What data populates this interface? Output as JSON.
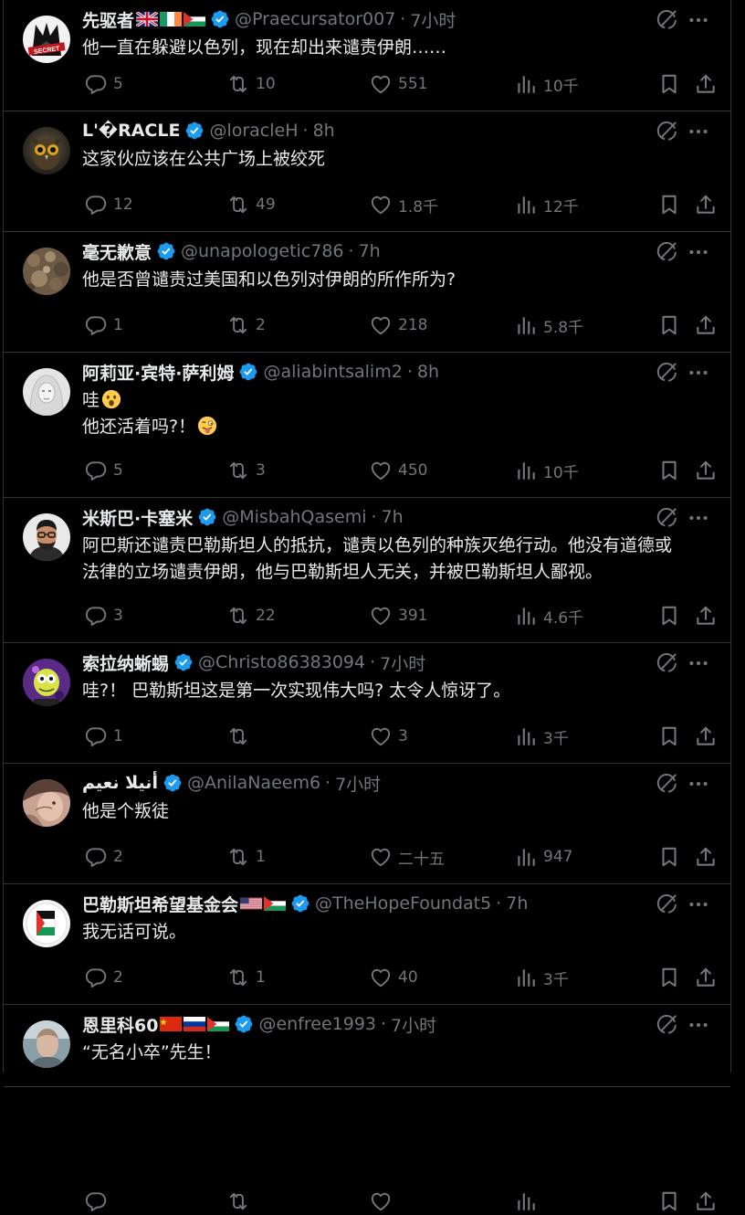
{
  "colors": {
    "background": "#000000",
    "text_primary": "#e7e9ea",
    "text_secondary": "#71767b",
    "divider": "#2f3336",
    "verified_blue": "#1d9bf0"
  },
  "tweets": [
    {
      "name": "先驱者",
      "flags": [
        "uk",
        "ireland",
        "palestine"
      ],
      "handle": "@Praecursator007",
      "time": "7小时",
      "lines": [
        "他一直在躲避以色列，现在却出来谴责伊朗……"
      ],
      "emoji": [],
      "stats": {
        "replies": "5",
        "retweets": "10",
        "likes": "551",
        "views": "10千"
      },
      "avatar": "wolf-logo"
    },
    {
      "name": "L'�RACLE",
      "flags": [],
      "handle": "@loracleH",
      "time": "8h",
      "lines": [
        "这家伙应该在公共广场上被绞死"
      ],
      "emoji": [],
      "stats": {
        "replies": "12",
        "retweets": "49",
        "likes": "1.8千",
        "views": "12千"
      },
      "avatar": "owl"
    },
    {
      "name": "毫无歉意",
      "flags": [],
      "handle": "@unapologetic786",
      "time": "7h",
      "lines": [
        "他是否曾谴责过美国和以色列对伊朗的所作所为?"
      ],
      "emoji": [],
      "stats": {
        "replies": "1",
        "retweets": "2",
        "likes": "218",
        "views": "5.8千"
      },
      "avatar": "texture"
    },
    {
      "name": "阿莉亚·宾特·萨利姆",
      "flags": [],
      "handle": "@aliabintsalim2",
      "time": "8h",
      "lines": [
        "哇",
        "他还活着吗?！"
      ],
      "emoji": [
        "astonished-face",
        "winking-tongue-face"
      ],
      "stats": {
        "replies": "5",
        "retweets": "3",
        "likes": "450",
        "views": "10千"
      },
      "avatar": "hijab-woman"
    },
    {
      "name": "米斯巴·卡塞米",
      "flags": [],
      "handle": "@MisbahQasemi",
      "time": "7h",
      "lines": [
        "阿巴斯还谴责巴勒斯坦人的抵抗，谴责以色列的种族灭绝行动。他没有道德或",
        "法律的立场谴责伊朗，他与巴勒斯坦人无关，并被巴勒斯坦人鄙视。"
      ],
      "emoji": [],
      "stats": {
        "replies": "3",
        "retweets": "22",
        "likes": "391",
        "views": "4.6千"
      },
      "avatar": "man-glasses"
    },
    {
      "name": "索拉纳蜥蜴",
      "flags": [],
      "handle": "@Christo86383094",
      "time": "7小时",
      "lines": [
        "哇?！ 巴勒斯坦这是第一次实现伟大吗? 太令人惊讶了。"
      ],
      "emoji": [],
      "stats": {
        "replies": "1",
        "retweets": "",
        "likes": "3",
        "views": "3千"
      },
      "avatar": "cartoon-lizard"
    },
    {
      "name": "أنيلا نعيم",
      "flags": [],
      "handle": "@AnilaNaeem6",
      "time": "7小时",
      "lines": [
        "他是个叛徒"
      ],
      "emoji": [],
      "stats": {
        "replies": "2",
        "retweets": "1",
        "likes": "二十五",
        "views": "947"
      },
      "avatar": "portrait-blur"
    },
    {
      "name": "巴勒斯坦希望基金会",
      "flags": [
        "usa",
        "palestine"
      ],
      "handle": "@TheHopeFoundat5",
      "time": "7h",
      "lines": [
        "我无话可说。"
      ],
      "emoji": [],
      "stats": {
        "replies": "2",
        "retweets": "1",
        "likes": "40",
        "views": "3千"
      },
      "avatar": "palestine-map"
    },
    {
      "name": "恩里科60",
      "flags": [
        "china",
        "russia",
        "palestine"
      ],
      "handle": "@enfree1993",
      "time": "7小时",
      "lines": [
        "“无名小卒”先生！"
      ],
      "emoji": [],
      "stats": {
        "replies": "",
        "retweets": "",
        "likes": "",
        "views": ""
      },
      "avatar": "man-photo"
    }
  ]
}
